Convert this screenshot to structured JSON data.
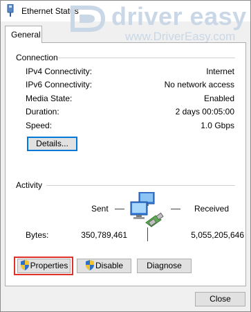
{
  "window": {
    "title": "Ethernet Status"
  },
  "watermark": {
    "brand": "driver easy",
    "url": "www.DriverEasy.com"
  },
  "tabs": [
    {
      "label": "General"
    }
  ],
  "connection": {
    "heading": "Connection",
    "rows": [
      {
        "label": "IPv4 Connectivity:",
        "value": "Internet"
      },
      {
        "label": "IPv6 Connectivity:",
        "value": "No network access"
      },
      {
        "label": "Media State:",
        "value": "Enabled"
      },
      {
        "label": "Duration:",
        "value": "2 days 00:05:00"
      },
      {
        "label": "Speed:",
        "value": "1.0 Gbps"
      }
    ],
    "details_button": "Details..."
  },
  "activity": {
    "heading": "Activity",
    "sent_label": "Sent",
    "received_label": "Received",
    "bytes_label": "Bytes:",
    "bytes_sent": "350,789,461",
    "bytes_received": "5,055,205,646"
  },
  "buttons": {
    "properties": "Properties",
    "disable": "Disable",
    "diagnose": "Diagnose",
    "close": "Close"
  },
  "colors": {
    "highlight_border": "#e0302a",
    "focus_border": "#0078d7",
    "watermark": "#c9d7e6"
  },
  "icons": [
    "ethernet-adapter-icon",
    "network-computers-icon",
    "uac-shield-icon",
    "driver-easy-logo"
  ]
}
